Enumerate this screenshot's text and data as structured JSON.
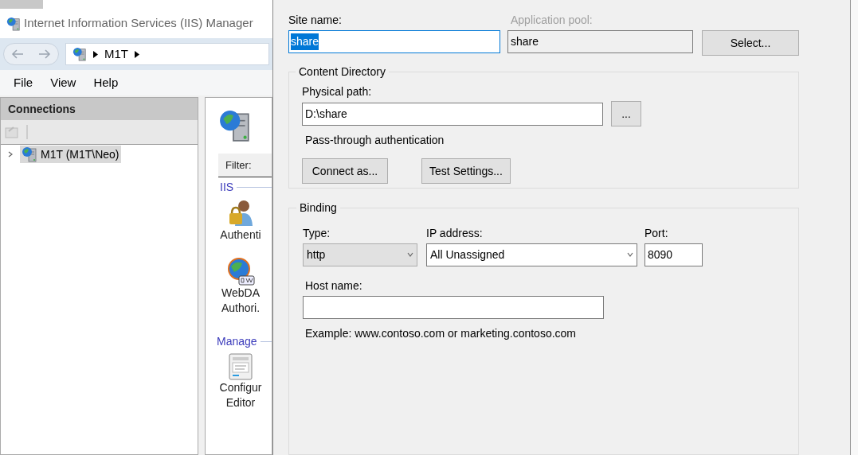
{
  "iis_window": {
    "title": "Internet Information Services (IIS) Manager",
    "address": {
      "segments": [
        "M1T"
      ]
    },
    "menu": [
      "File",
      "View",
      "Help"
    ],
    "connections": {
      "title": "Connections",
      "tree": [
        {
          "label": "M1T (M1T\\Neo)",
          "expanded": false,
          "selected": true
        }
      ]
    },
    "features": {
      "filter_label": "Filter:",
      "groups": [
        {
          "label": "IIS",
          "items": [
            {
              "kind": "auth",
              "lines": [
                "Authenti"
              ]
            },
            {
              "kind": "webdav",
              "lines": [
                "WebDA",
                "Authori."
              ]
            }
          ]
        },
        {
          "label": "Manage",
          "items": [
            {
              "kind": "config",
              "lines": [
                "Configur",
                "Editor"
              ]
            }
          ]
        }
      ]
    }
  },
  "dialog": {
    "site_name": {
      "label": "Site name:",
      "value": "share",
      "text_selected": true
    },
    "application_pool": {
      "label": "Application pool:",
      "value": "share",
      "disabled": true,
      "button": "Select..."
    },
    "content_directory": {
      "title": "Content Directory",
      "physical_path": {
        "label": "Physical path:",
        "value": "D:\\share",
        "browse_button": "..."
      },
      "authentication": "Pass-through authentication",
      "buttons": [
        "Connect as...",
        "Test Settings..."
      ]
    },
    "binding": {
      "title": "Binding",
      "type": {
        "label": "Type:",
        "value": "http"
      },
      "ip_address": {
        "label": "IP address:",
        "value": "All Unassigned"
      },
      "port": {
        "label": "Port:",
        "value": "8090"
      },
      "host_name": {
        "label": "Host name:"
      },
      "example": "Example: www.contoso.com or marketing.contoso.com"
    }
  }
}
